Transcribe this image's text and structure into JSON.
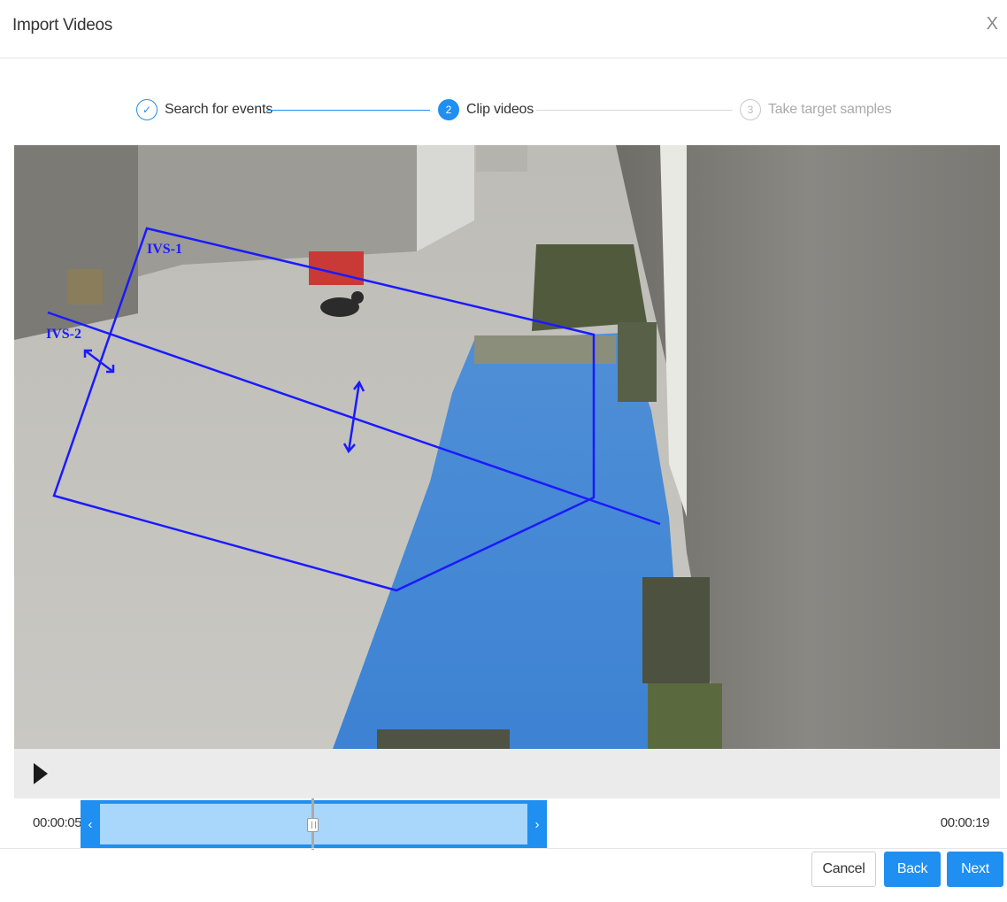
{
  "dialog": {
    "title": "Import Videos",
    "close_label": "X"
  },
  "steps": [
    {
      "number": "✓",
      "label": "Search for events",
      "state": "done"
    },
    {
      "number": "2",
      "label": "Clip videos",
      "state": "active"
    },
    {
      "number": "3",
      "label": "Take target samples",
      "state": "todo"
    }
  ],
  "video": {
    "rules": [
      {
        "label": "IVS-1"
      },
      {
        "label": "IVS-2"
      }
    ],
    "rule_color": "#1a1aff"
  },
  "timeline": {
    "start_time": "00:00:05",
    "end_time": "00:00:19",
    "left_handle": "‹",
    "right_handle": "›",
    "playhead_fraction": 0.5
  },
  "footer": {
    "cancel_label": "Cancel",
    "back_label": "Back",
    "next_label": "Next"
  },
  "colors": {
    "accent": "#1f8ff1",
    "inactive": "#c8c8c8"
  }
}
